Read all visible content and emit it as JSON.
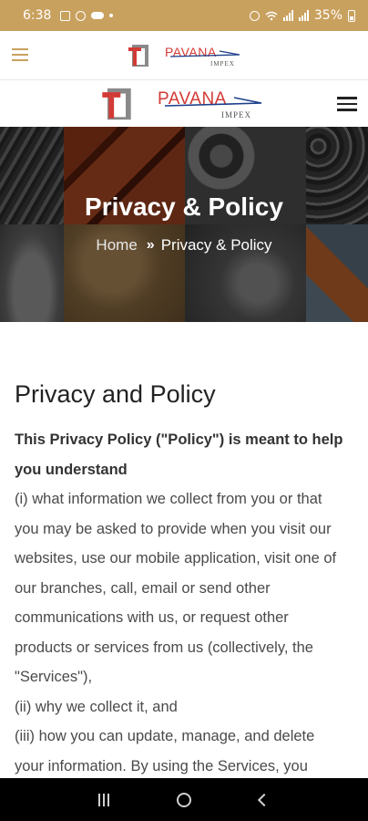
{
  "status_bar": {
    "time": "6:38",
    "battery": "35%",
    "icons": [
      "gallery-icon",
      "settings-icon",
      "cloud-icon",
      "dot-icon",
      "alarm-icon",
      "wifi-icon",
      "signal-icon",
      "signal-icon",
      "battery-icon"
    ]
  },
  "app_bar": {
    "menu_icon": "hamburger-icon",
    "logo": {
      "name": "PAVANA",
      "sub": "IMPEX"
    }
  },
  "site_header": {
    "logo": {
      "name": "PAVANA",
      "sub": "IMPEX"
    },
    "menu_icon": "hamburger-icon"
  },
  "hero": {
    "title": "Privacy & Policy",
    "breadcrumb": {
      "home": "Home",
      "separator": "»",
      "current": "Privacy & Policy"
    }
  },
  "content": {
    "heading": "Privacy and Policy",
    "intro_lines": [
      "This Privacy Policy (\"Policy\") is meant to help",
      "you understand"
    ],
    "body_lines": [
      "(i) what information we collect from you or that",
      "you may be asked to provide when you visit our",
      "websites, use our mobile application, visit one of",
      "our branches, call, email or send other",
      "communications with us, or request other",
      "products or services from us (collectively, the",
      "\"Services\"),",
      "(ii) why we collect it, and",
      "(iii) how you can update, manage, and delete",
      "your information. By using the Services, you"
    ]
  },
  "colors": {
    "status_bar": "#c9a15e",
    "brand_red": "#d23a35",
    "brand_blue": "#1c3f8a",
    "nav_bar": "#000000"
  },
  "nav_bar": {
    "buttons": [
      "recents-icon",
      "home-icon",
      "back-icon"
    ]
  }
}
